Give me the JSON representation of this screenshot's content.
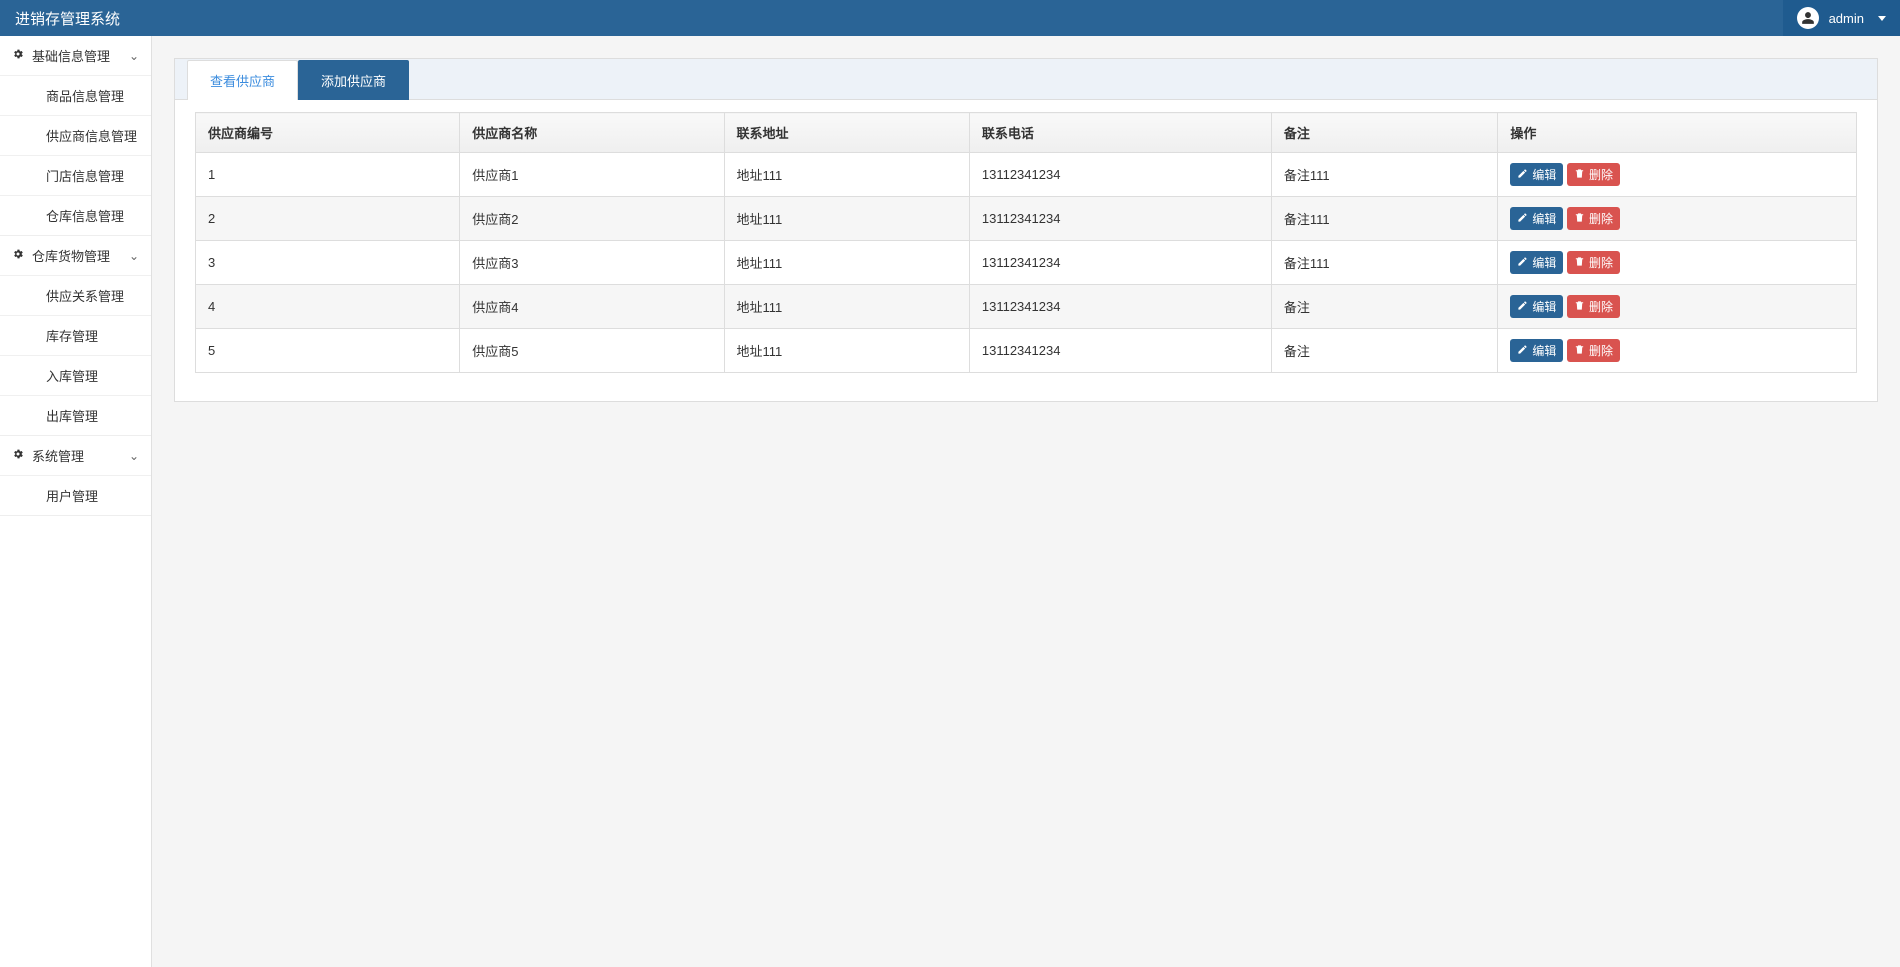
{
  "app": {
    "title": "进销存管理系统"
  },
  "user": {
    "name": "admin"
  },
  "sidebar": {
    "groups": [
      {
        "label": "基础信息管理",
        "items": [
          {
            "label": "商品信息管理"
          },
          {
            "label": "供应商信息管理"
          },
          {
            "label": "门店信息管理"
          },
          {
            "label": "仓库信息管理"
          }
        ]
      },
      {
        "label": "仓库货物管理",
        "items": [
          {
            "label": "供应关系管理"
          },
          {
            "label": "库存管理"
          },
          {
            "label": "入库管理"
          },
          {
            "label": "出库管理"
          }
        ]
      },
      {
        "label": "系统管理",
        "items": [
          {
            "label": "用户管理"
          }
        ]
      }
    ]
  },
  "tabs": {
    "view": "查看供应商",
    "add": "添加供应商"
  },
  "table": {
    "headers": {
      "id": "供应商编号",
      "name": "供应商名称",
      "address": "联系地址",
      "phone": "联系电话",
      "remark": "备注",
      "ops": "操作"
    },
    "rows": [
      {
        "id": "1",
        "name": "供应商1",
        "address": "地址111",
        "phone": "13112341234",
        "remark": "备注111"
      },
      {
        "id": "2",
        "name": "供应商2",
        "address": "地址111",
        "phone": "13112341234",
        "remark": "备注111"
      },
      {
        "id": "3",
        "name": "供应商3",
        "address": "地址111",
        "phone": "13112341234",
        "remark": "备注111"
      },
      {
        "id": "4",
        "name": "供应商4",
        "address": "地址111",
        "phone": "13112341234",
        "remark": "备注"
      },
      {
        "id": "5",
        "name": "供应商5",
        "address": "地址111",
        "phone": "13112341234",
        "remark": "备注"
      }
    ]
  },
  "buttons": {
    "edit": "编辑",
    "delete": "删除"
  }
}
